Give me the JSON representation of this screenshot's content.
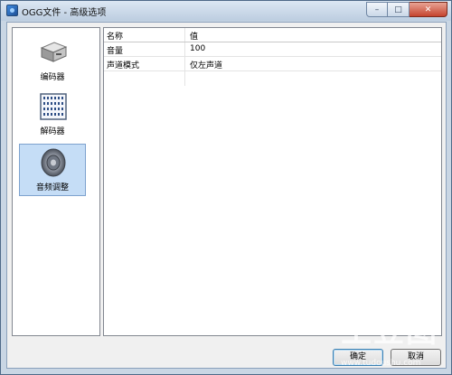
{
  "window": {
    "title": "OGG文件 - 高级选项"
  },
  "caption_buttons": {
    "minimize": "–",
    "maximize": "□",
    "close": "✕"
  },
  "sidebar": {
    "items": [
      {
        "label": "编码器",
        "icon": "encoder-icon"
      },
      {
        "label": "解码器",
        "icon": "decoder-icon"
      },
      {
        "label": "音频调整",
        "icon": "speaker-icon",
        "selected": true
      }
    ]
  },
  "table": {
    "columns": [
      "名称",
      "值"
    ],
    "rows": [
      {
        "name": "音量",
        "value": "100"
      },
      {
        "name": "声道模式",
        "value": "仅左声道"
      }
    ]
  },
  "buttons": {
    "ok": "确定",
    "cancel": "取消"
  },
  "watermark": {
    "text": "土豆图",
    "url": "www.tudoushu.com"
  }
}
